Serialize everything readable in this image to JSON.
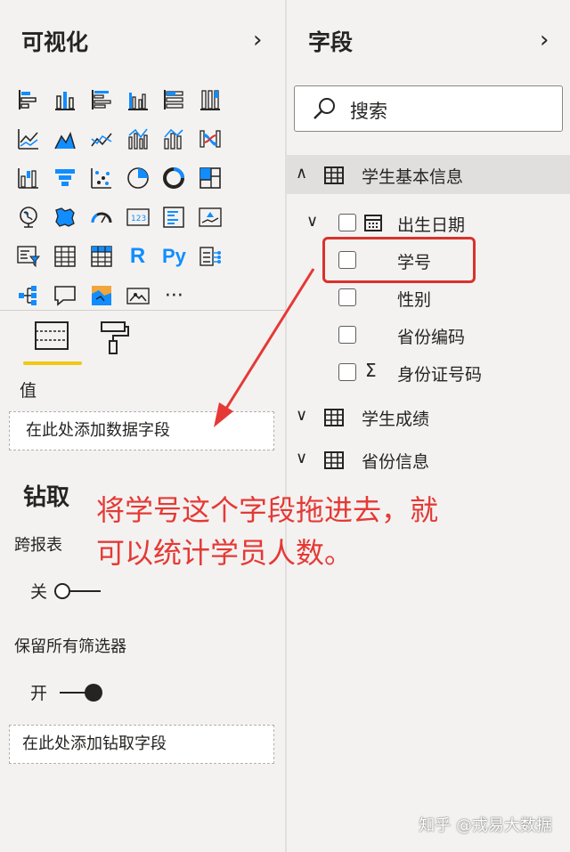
{
  "viz_pane": {
    "title": "可视化",
    "values_label": "值",
    "values_well": "在此处添加数据字段",
    "drill_title": "钻取",
    "cross_report_label": "跨报表",
    "cross_report_state": "关",
    "keep_filters_label": "保留所有筛选器",
    "keep_filters_state": "开",
    "drill_well": "在此处添加钻取字段",
    "viz_icons": [
      "stacked-bar",
      "stacked-column",
      "clustered-bar",
      "clustered-column",
      "100-stacked-bar",
      "100-stacked-column",
      "line",
      "area",
      "stacked-area",
      "line-clustered-column",
      "line-stacked-column",
      "ribbon",
      "waterfall",
      "funnel",
      "scatter",
      "pie",
      "donut",
      "treemap",
      "map",
      "filled-map",
      "gauge",
      "card",
      "multi-row-card",
      "kpi",
      "slicer",
      "table",
      "matrix",
      "r-visual",
      "python-visual",
      "key-influencers",
      "decomposition-tree",
      "qa",
      "shape-map",
      "arcgis",
      "more"
    ],
    "r_label": "R",
    "py_label": "Py",
    "more_label": "···"
  },
  "fields_pane": {
    "title": "字段",
    "search_placeholder": "搜索",
    "tables": [
      {
        "name": "学生基本信息",
        "expanded": true,
        "fields": [
          {
            "name": "出生日期",
            "type": "date-hierarchy"
          },
          {
            "name": "学号",
            "type": "field"
          },
          {
            "name": "性别",
            "type": "field"
          },
          {
            "name": "省份编码",
            "type": "field"
          },
          {
            "name": "身份证号码",
            "type": "sum"
          }
        ]
      },
      {
        "name": "学生成绩",
        "expanded": false
      },
      {
        "name": "省份信息",
        "expanded": false
      }
    ]
  },
  "annotation": {
    "line1": "将学号这个字段拖进去，就",
    "line2": "可以统计学员人数。"
  },
  "watermark": "知乎 @戎易大数据",
  "colors": {
    "accent": "#f2c811",
    "annotation": "#e53935",
    "highlight": "#d9322c",
    "blue": "#118dff"
  }
}
